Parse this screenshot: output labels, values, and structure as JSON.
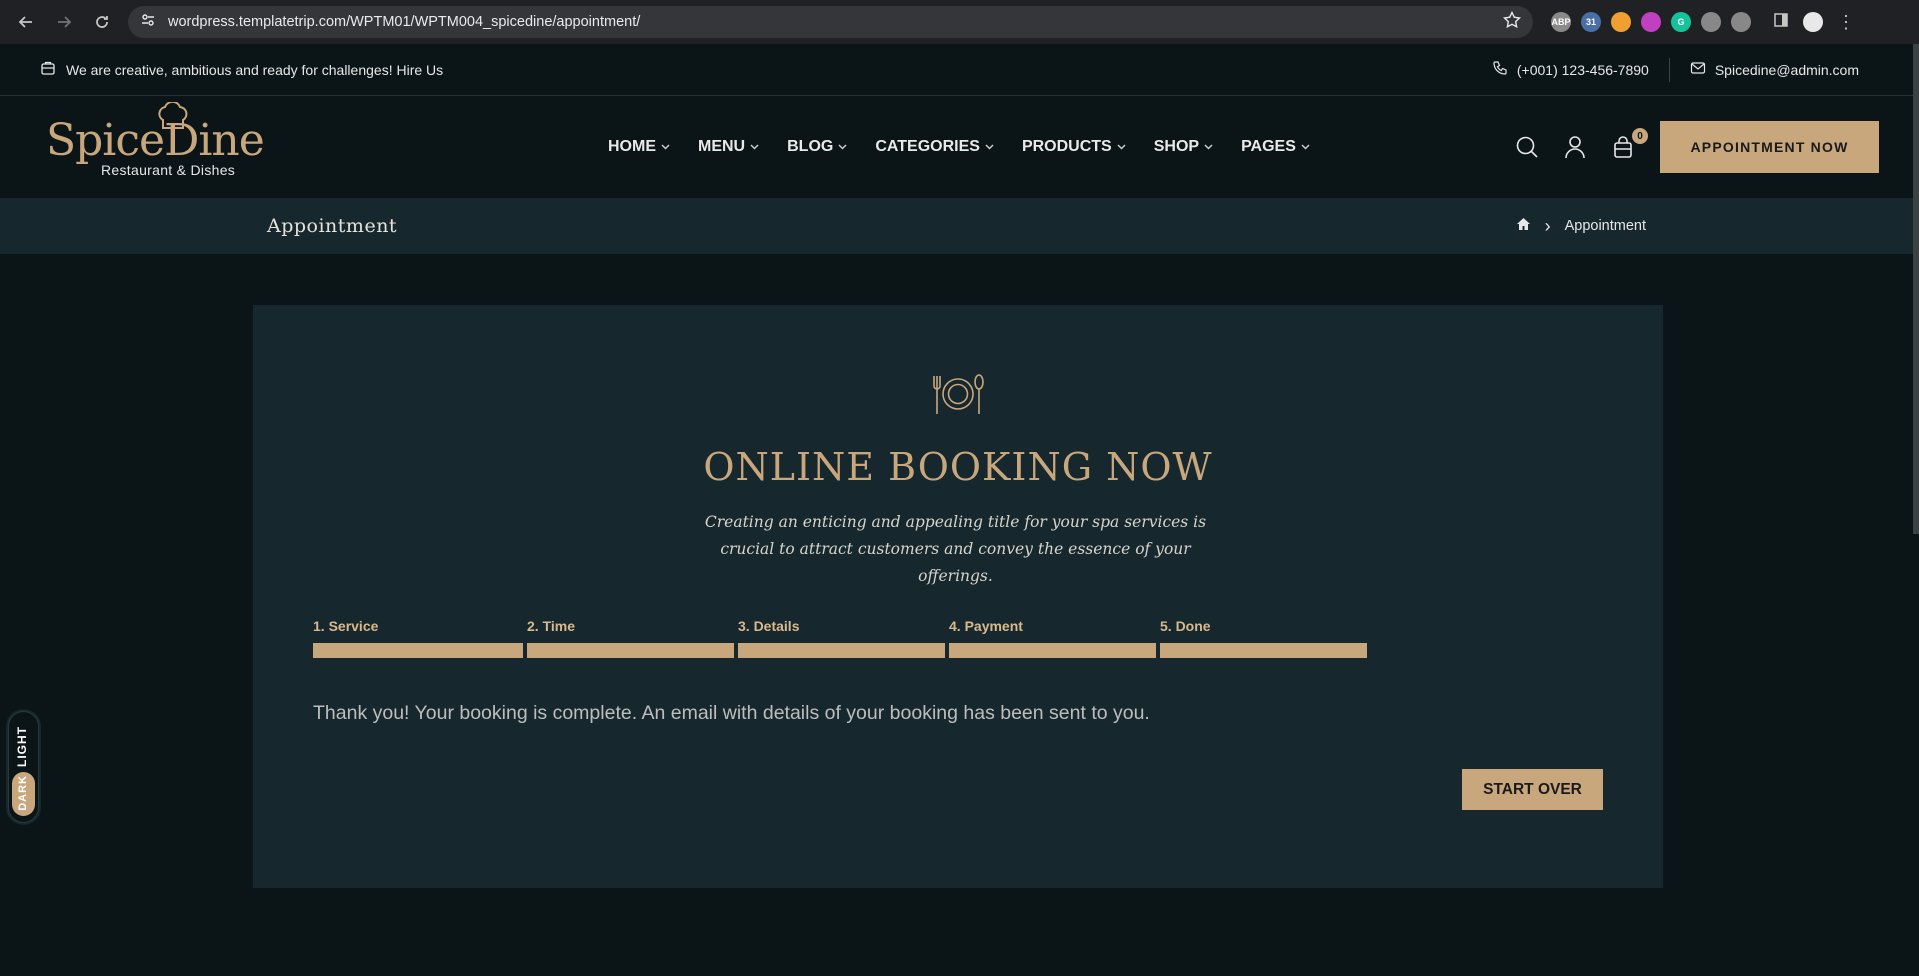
{
  "browser": {
    "url": "wordpress.templatetrip.com/WPTM01/WPTM004_spicedine/appointment/",
    "extensions": [
      {
        "name": "abp-icon",
        "color": "#8a8a8a",
        "label": "ABP"
      },
      {
        "name": "calendar-icon",
        "color": "#4a6fa5",
        "label": "31"
      },
      {
        "name": "moon-icon",
        "color": "#f0a030",
        "label": ""
      },
      {
        "name": "colorwheel-icon",
        "color": "#c040c0",
        "label": ""
      },
      {
        "name": "grammarly-icon",
        "color": "#15c39a",
        "label": "G"
      },
      {
        "name": "eye-icon",
        "color": "#888888",
        "label": ""
      },
      {
        "name": "puzzle-icon",
        "color": "#888888",
        "label": ""
      }
    ]
  },
  "topbar": {
    "tagline": "We are creative, ambitious and ready for challenges! Hire Us",
    "phone": "(+001) 123-456-7890",
    "email": "Spicedine@admin.com"
  },
  "header": {
    "logo_brand": "SpiceDine",
    "logo_tag": "Restaurant & Dishes",
    "nav": [
      {
        "label": "HOME",
        "name": "nav-home"
      },
      {
        "label": "MENU",
        "name": "nav-menu"
      },
      {
        "label": "BLOG",
        "name": "nav-blog"
      },
      {
        "label": "CATEGORIES",
        "name": "nav-categories"
      },
      {
        "label": "PRODUCTS",
        "name": "nav-products"
      },
      {
        "label": "SHOP",
        "name": "nav-shop"
      },
      {
        "label": "PAGES",
        "name": "nav-pages"
      }
    ],
    "cart_count": "0",
    "appointment_label": "APPOINTMENT NOW"
  },
  "breadcrumb": {
    "page_title": "Appointment",
    "separator": "›",
    "current": "Appointment"
  },
  "booking": {
    "heading": "ONLINE BOOKING NOW",
    "subtitle": "Creating an enticing and appealing title for your spa services is crucial to attract customers and convey the essence of your offerings.",
    "steps": [
      {
        "label": "1. Service",
        "name": "step-service"
      },
      {
        "label": "2. Time",
        "name": "step-time"
      },
      {
        "label": "3. Details",
        "name": "step-details"
      },
      {
        "label": "4. Payment",
        "name": "step-payment"
      },
      {
        "label": "5. Done",
        "name": "step-done"
      }
    ],
    "message": "Thank you! Your booking is complete. An email with details of your booking has been sent to you.",
    "start_over_label": "START OVER"
  },
  "theme_toggle": {
    "light_label": "LIGHT",
    "dark_label": "DARK"
  },
  "colors": {
    "accent": "#c9a77c",
    "background": "#0b1517",
    "panel": "#16282e"
  }
}
